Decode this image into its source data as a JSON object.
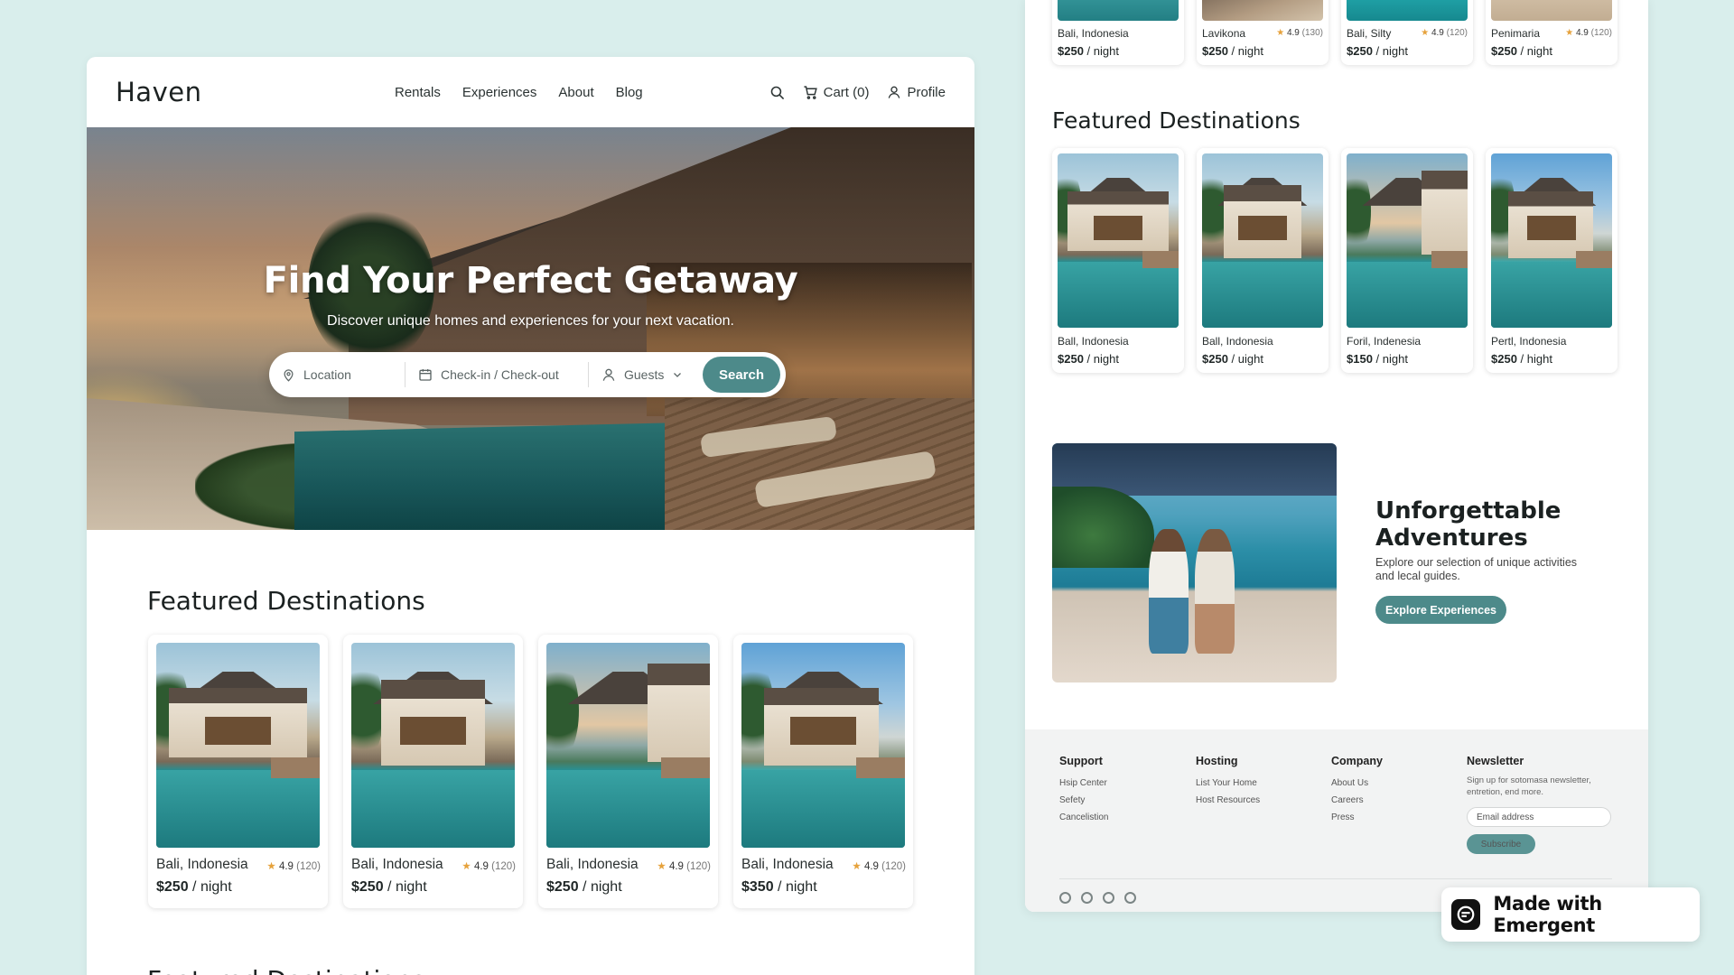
{
  "brand": "Haven",
  "nav": {
    "links": [
      "Rentals",
      "Experiences",
      "About",
      "Blog"
    ],
    "cart_label": "Cart (0)",
    "profile_label": "Profile"
  },
  "hero": {
    "title": "Find Your Perfect Getaway",
    "subtitle": "Discover unique homes and experiences for your next vacation.",
    "location_placeholder": "Location",
    "dates_placeholder": "Check-in / Check-out",
    "guests_label": "Guests",
    "search_label": "Search"
  },
  "featured": {
    "title": "Featured Destinations",
    "cards": [
      {
        "location": "Bali, Indonesia",
        "rating": "4.9",
        "reviews": "(120)",
        "price": "$250",
        "unit": "/ night"
      },
      {
        "location": "Bali, Indonesia",
        "rating": "4.9",
        "reviews": "(120)",
        "price": "$250",
        "unit": "/ night"
      },
      {
        "location": "Bali, Indonesia",
        "rating": "4.9",
        "reviews": "(120)",
        "price": "$250",
        "unit": "/ night"
      },
      {
        "location": "Bali, Indonesia",
        "rating": "4.9",
        "reviews": "(120)",
        "price": "$350",
        "unit": "/ night"
      }
    ],
    "next_title": "Featured Destinations"
  },
  "right": {
    "top_cards": [
      {
        "location": "Bali, Indonesia",
        "rating": "",
        "reviews": "",
        "price": "$250",
        "unit": "/ night"
      },
      {
        "location": "Lavikona",
        "rating": "4.9",
        "reviews": "(130)",
        "price": "$250",
        "unit": "/ night"
      },
      {
        "location": "Bali, Silty",
        "rating": "4.9",
        "reviews": "(120)",
        "price": "$250",
        "unit": "/ night"
      },
      {
        "location": "Penimaria",
        "rating": "4.9",
        "reviews": "(120)",
        "price": "$250",
        "unit": "/ night"
      }
    ],
    "featured_title": "Featured Destinations",
    "featured_cards": [
      {
        "location": "Ball, Indonesia",
        "price": "$250",
        "unit": "/ night"
      },
      {
        "location": "Ball, Indonesia",
        "price": "$250",
        "unit": "/ uight"
      },
      {
        "location": "Foril, Indenesia",
        "price": "$150",
        "unit": "/ night"
      },
      {
        "location": "Pertl, Indonesia",
        "price": "$250",
        "unit": "/ hight"
      }
    ],
    "adventure": {
      "title": "Unforgettable Adventures",
      "text": "Explore our selection of unique activities and lecal guides.",
      "button": "Explore Experiences"
    },
    "footer": {
      "columns": [
        {
          "title": "Support",
          "items": [
            "Hsip Center",
            "Sefety",
            "Cancelistion"
          ]
        },
        {
          "title": "Hosting",
          "items": [
            "List Your Home",
            "Host Resources"
          ]
        },
        {
          "title": "Company",
          "items": [
            "About Us",
            "Careers",
            "Press"
          ]
        }
      ],
      "newsletter": {
        "title": "Newsletter",
        "text": "Sign up for sotomasa newsletter, entretion, end more.",
        "placeholder": "Email address",
        "button": "Subscribe"
      }
    }
  },
  "badge": "Made with Emergent",
  "colors": {
    "accent": "#4d8a8a",
    "background": "#d9eeec",
    "star": "#e6a23c"
  },
  "icons": [
    "search-icon",
    "cart-icon",
    "user-icon",
    "location-pin-icon",
    "calendar-icon",
    "guests-icon",
    "chevron-down-icon",
    "star-icon",
    "social-icon"
  ]
}
